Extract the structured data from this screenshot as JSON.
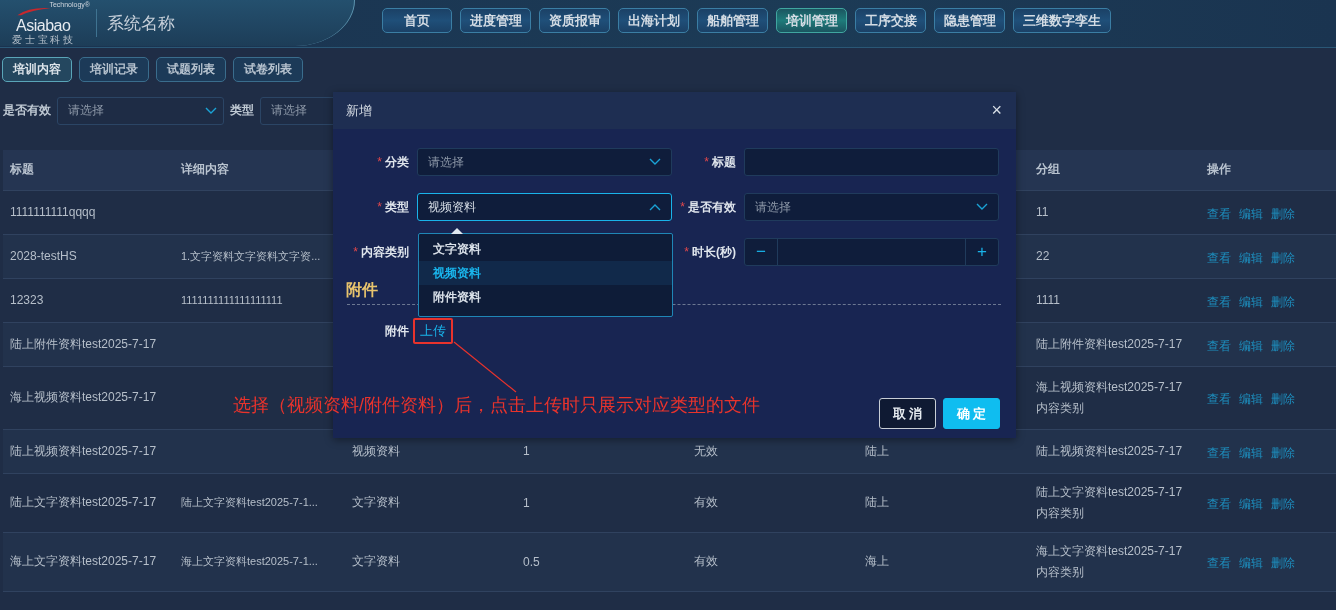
{
  "header": {
    "logo": {
      "wordmark": "Asiabao",
      "tagline": "Technology®",
      "subtitle": "爱 士 宝 科 技"
    },
    "system_name": "系统名称"
  },
  "nav": [
    {
      "label": "首页",
      "selected": false
    },
    {
      "label": "进度管理",
      "selected": false
    },
    {
      "label": "资质报审",
      "selected": false
    },
    {
      "label": "出海计划",
      "selected": false
    },
    {
      "label": "船舶管理",
      "selected": false
    },
    {
      "label": "培训管理",
      "selected": true
    },
    {
      "label": "工序交接",
      "selected": false
    },
    {
      "label": "隐患管理",
      "selected": false
    },
    {
      "label": "三维数字孪生",
      "selected": false
    }
  ],
  "sub_tabs": [
    {
      "label": "培训内容",
      "selected": true
    },
    {
      "label": "培训记录",
      "selected": false
    },
    {
      "label": "试题列表",
      "selected": false
    },
    {
      "label": "试卷列表",
      "selected": false
    }
  ],
  "filters": [
    {
      "label": "是否有效",
      "placeholder": "请选择"
    },
    {
      "label": "类型",
      "placeholder": "请选择"
    }
  ],
  "table": {
    "columns": {
      "title": "标题",
      "detail": "详细内容",
      "group": "分组",
      "actions": "操作"
    },
    "rows": [
      {
        "title": "1111111111qqqq",
        "group": [
          "11"
        ],
        "actions": [
          "查看",
          "编辑",
          "删除"
        ]
      },
      {
        "title": "2028-testHS",
        "detail": "1.文字资料文字资料文字资...",
        "group": [
          "22"
        ],
        "actions": [
          "查看",
          "编辑",
          "删除"
        ]
      },
      {
        "title": "12323",
        "detail": "1111111111111111111",
        "group": [
          "1111"
        ],
        "actions": [
          "查看",
          "编辑",
          "删除"
        ]
      },
      {
        "title": "陆上附件资料test2025-7-17",
        "group": [
          "陆上附件资料test2025-7-17"
        ],
        "actions": [
          "查看",
          "编辑",
          "删除"
        ]
      },
      {
        "title": "海上视频资料test2025-7-17",
        "group": [
          "海上视频资料test2025-7-17",
          "内容类别"
        ],
        "actions": [
          "查看",
          "编辑",
          "删除"
        ]
      },
      {
        "title": "陆上视频资料test2025-7-17",
        "column_3": "视频资料",
        "column_4": "1",
        "column_5": "无效",
        "column_6": "陆上",
        "group": [
          "陆上视频资料test2025-7-17"
        ],
        "actions": [
          "查看",
          "编辑",
          "删除"
        ]
      },
      {
        "title": "陆上文字资料test2025-7-17",
        "detail": "陆上文字资料test2025-7-1...",
        "column_3": "文字资料",
        "column_4": "1",
        "column_5": "有效",
        "column_6": "陆上",
        "group": [
          "陆上文字资料test2025-7-17",
          "内容类别"
        ],
        "actions": [
          "查看",
          "编辑",
          "删除"
        ]
      },
      {
        "title": "海上文字资料test2025-7-17",
        "detail": "海上文字资料test2025-7-1...",
        "column_3": "文字资料",
        "column_4": "0.5",
        "column_5": "有效",
        "column_6": "海上",
        "group": [
          "海上文字资料test2025-7-17",
          "内容类别"
        ],
        "actions": [
          "查看",
          "编辑",
          "删除"
        ]
      }
    ]
  },
  "modal": {
    "title": "新增",
    "close": "×",
    "fields": [
      {
        "kind": "select",
        "label": "分类",
        "mark": "*",
        "placeholder": "请选择",
        "open": false
      },
      {
        "kind": "input",
        "label": "标题",
        "mark": "*"
      },
      {
        "kind": "select",
        "label": "类型",
        "mark": "*",
        "value": "视频资料",
        "open": true
      },
      {
        "kind": "select",
        "label": "是否有效",
        "mark": "*",
        "placeholder": "请选择",
        "open": false
      },
      {
        "kind": "covered",
        "label": "内容类别",
        "mark": "*"
      },
      {
        "kind": "number",
        "label": "时长(秒)",
        "mark": "*",
        "decrement": "−",
        "increment": "+"
      }
    ],
    "dropdown_options": [
      {
        "label": "文字资料",
        "selected": false
      },
      {
        "label": "视频资料",
        "selected": true
      },
      {
        "label": "附件资料",
        "selected": false
      }
    ],
    "section_title": "附件",
    "upload_label": "附件",
    "upload_link": "上传",
    "buttons": [
      {
        "kind": "secondary",
        "label": "取 消"
      },
      {
        "kind": "primary",
        "label": "确 定"
      }
    ]
  },
  "annotation": "选择（视频资料/附件资料）后，点击上传时只展示对应类型的文件"
}
